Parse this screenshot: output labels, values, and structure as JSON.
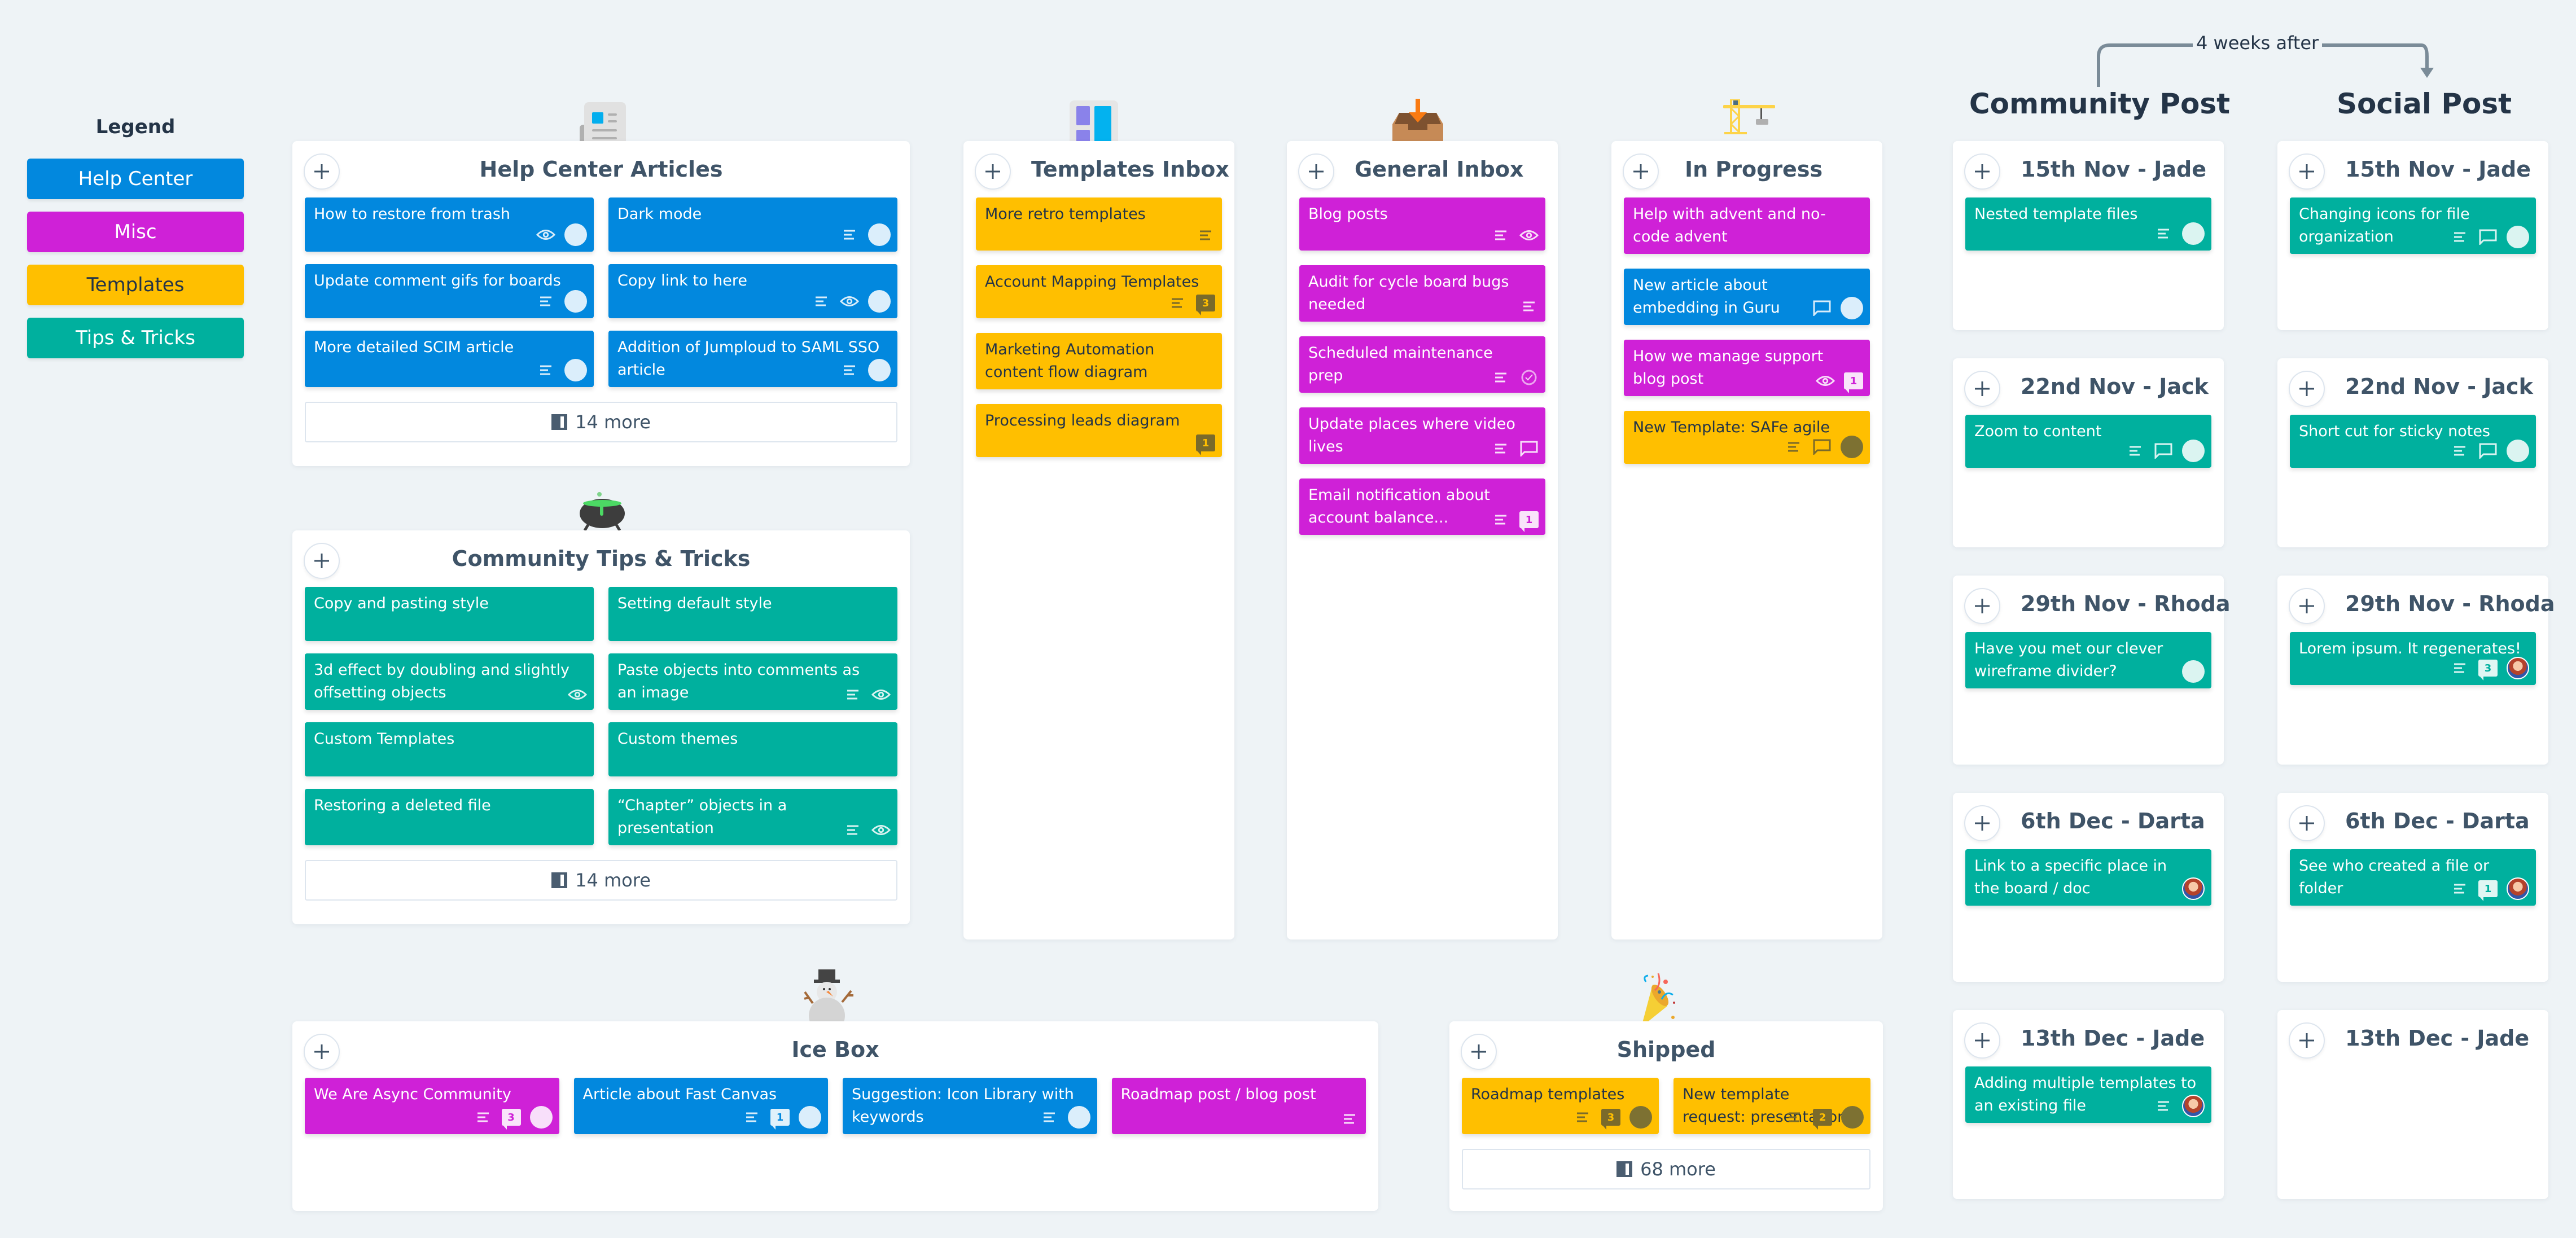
{
  "colors": {
    "help_center": "#0288de",
    "misc": "#cf21d7",
    "templates": "#ffbf00",
    "tips_tricks": "#00b09e",
    "background": "#eef3f6",
    "title_text": "#3f5468"
  },
  "legend": {
    "title": "Legend",
    "items": [
      {
        "label": "Help Center",
        "category": "help_center"
      },
      {
        "label": "Misc",
        "category": "misc"
      },
      {
        "label": "Templates",
        "category": "templates"
      },
      {
        "label": "Tips & Tricks",
        "category": "tips_tricks"
      }
    ]
  },
  "columns": {
    "help_center_articles": {
      "title": "Help Center Articles",
      "icon": "newspaper-icon",
      "more_label": "14 more",
      "cards": [
        {
          "text": "How to restore from trash",
          "category": "help_center",
          "meta": [
            "eye",
            "avatar"
          ]
        },
        {
          "text": "Dark mode",
          "category": "help_center",
          "meta": [
            "notes",
            "avatar"
          ]
        },
        {
          "text": "Update comment gifs for boards",
          "category": "help_center",
          "meta": [
            "notes",
            "avatar"
          ]
        },
        {
          "text": "Copy link to here",
          "category": "help_center",
          "meta": [
            "notes",
            "eye",
            "avatar"
          ]
        },
        {
          "text": "More detailed SCIM article",
          "category": "help_center",
          "meta": [
            "notes",
            "avatar"
          ]
        },
        {
          "text": "Addition of Jumploud to SAML SSO article",
          "category": "help_center",
          "meta": [
            "notes",
            "avatar"
          ]
        }
      ]
    },
    "community_tips": {
      "title": "Community Tips & Tricks",
      "icon": "cauldron-icon",
      "more_label": "14 more",
      "cards": [
        {
          "text": "Copy and pasting style",
          "category": "tips_tricks",
          "meta": []
        },
        {
          "text": "Setting default style",
          "category": "tips_tricks",
          "meta": []
        },
        {
          "text": "3d effect by doubling and slightly offsetting objects",
          "category": "tips_tricks",
          "meta": [
            "eye"
          ]
        },
        {
          "text": "Paste objects into comments as an image",
          "category": "tips_tricks",
          "meta": [
            "notes",
            "eye"
          ]
        },
        {
          "text": "Custom Templates",
          "category": "tips_tricks",
          "meta": []
        },
        {
          "text": "Custom themes",
          "category": "tips_tricks",
          "meta": []
        },
        {
          "text": "Restoring a deleted file",
          "category": "tips_tricks",
          "meta": []
        },
        {
          "text": "“Chapter” objects in a presentation",
          "category": "tips_tricks",
          "meta": [
            "notes",
            "eye"
          ]
        }
      ]
    },
    "templates_inbox": {
      "title": "Templates Inbox",
      "icon": "layout-icon",
      "cards": [
        {
          "text": "More retro templates",
          "category": "templates",
          "meta": [
            "notes"
          ]
        },
        {
          "text": "Account Mapping Templates",
          "category": "templates",
          "meta": [
            "notes",
            "comments:3"
          ]
        },
        {
          "text": "Marketing Automation content flow diagram",
          "category": "templates",
          "meta": []
        },
        {
          "text": "Processing leads diagram",
          "category": "templates",
          "meta": [
            "comments:1"
          ]
        }
      ]
    },
    "general_inbox": {
      "title": "General Inbox",
      "icon": "inbox-tray-icon",
      "cards": [
        {
          "text": "Blog posts",
          "category": "misc",
          "meta": [
            "notes",
            "eye"
          ]
        },
        {
          "text": "Audit for cycle board bugs needed",
          "category": "misc",
          "meta": [
            "notes"
          ]
        },
        {
          "text": "Scheduled maintenance prep",
          "category": "misc",
          "meta": [
            "notes",
            "progress"
          ]
        },
        {
          "text": "Update places where video lives",
          "category": "misc",
          "meta": [
            "notes",
            "comment"
          ]
        },
        {
          "text": "Email notification about account balance...",
          "category": "misc",
          "meta": [
            "notes",
            "comments:1"
          ]
        }
      ]
    },
    "in_progress": {
      "title": "In Progress",
      "icon": "crane-icon",
      "cards": [
        {
          "text": "Help with advent and no-code advent",
          "category": "misc",
          "meta": []
        },
        {
          "text": "New article about embedding in Guru",
          "category": "help_center",
          "meta": [
            "comment",
            "avatar"
          ]
        },
        {
          "text": "How we manage support blog post",
          "category": "misc",
          "meta": [
            "eye",
            "comments:1"
          ]
        },
        {
          "text": "New Template: SAFe agile",
          "category": "templates",
          "meta": [
            "notes",
            "comment",
            "avatar"
          ]
        }
      ]
    },
    "ice_box": {
      "title": "Ice Box",
      "icon": "snowman-icon",
      "cards": [
        {
          "text": "We Are Async Community",
          "category": "misc",
          "meta": [
            "notes",
            "comments:3",
            "avatar"
          ]
        },
        {
          "text": "Article about Fast Canvas",
          "category": "help_center",
          "meta": [
            "notes",
            "comments:1",
            "avatar"
          ]
        },
        {
          "text": "Suggestion: Icon Library with keywords",
          "category": "help_center",
          "meta": [
            "notes",
            "avatar"
          ]
        },
        {
          "text": "Roadmap post / blog post",
          "category": "misc",
          "meta": [
            "notes"
          ]
        }
      ]
    },
    "shipped": {
      "title": "Shipped",
      "icon": "party-popper-icon",
      "more_label": "68 more",
      "cards": [
        {
          "text": "Roadmap templates",
          "category": "templates",
          "meta": [
            "notes",
            "comments:3",
            "avatar"
          ]
        },
        {
          "text": "New template request: presentation",
          "category": "templates",
          "meta": [
            "notes",
            "comments:2",
            "avatar"
          ]
        }
      ]
    }
  },
  "schedule": {
    "connector_label": "4 weeks after",
    "community_post": {
      "title": "Community Post",
      "slots": [
        {
          "title": "15th Nov - Jade",
          "cards": [
            {
              "text": "Nested template files",
              "category": "tips_tricks",
              "meta": [
                "notes",
                "avatar"
              ]
            }
          ]
        },
        {
          "title": "22nd Nov - Jack",
          "cards": [
            {
              "text": "Zoom to content",
              "category": "tips_tricks",
              "meta": [
                "notes",
                "comment",
                "avatar"
              ]
            }
          ]
        },
        {
          "title": "29th Nov - Rhoda",
          "cards": [
            {
              "text": "Have you met our clever wireframe divider?",
              "category": "tips_tricks",
              "meta": [
                "avatar"
              ]
            }
          ]
        },
        {
          "title": "6th Dec - Darta",
          "cards": [
            {
              "text": "Link to a specific place in the board / doc",
              "category": "tips_tricks",
              "meta": [
                "avatar-photo"
              ]
            }
          ]
        },
        {
          "title": "13th Dec - Jade",
          "cards": [
            {
              "text": "Adding multiple templates to an existing file",
              "category": "tips_tricks",
              "meta": [
                "notes",
                "avatar-photo"
              ]
            }
          ]
        }
      ]
    },
    "social_post": {
      "title": "Social Post",
      "slots": [
        {
          "title": "15th Nov - Jade",
          "cards": [
            {
              "text": "Changing icons for file organization",
              "category": "tips_tricks",
              "meta": [
                "notes",
                "comment",
                "avatar"
              ]
            }
          ]
        },
        {
          "title": "22nd Nov - Jack",
          "cards": [
            {
              "text": "Short cut for sticky notes",
              "category": "tips_tricks",
              "meta": [
                "notes",
                "comment",
                "avatar"
              ]
            }
          ]
        },
        {
          "title": "29th Nov - Rhoda",
          "cards": [
            {
              "text": "Lorem ipsum. It regenerates!",
              "category": "tips_tricks",
              "meta": [
                "notes",
                "comments:3",
                "avatar-photo"
              ]
            }
          ]
        },
        {
          "title": "6th Dec - Darta",
          "cards": [
            {
              "text": "See who created a file or folder",
              "category": "tips_tricks",
              "meta": [
                "notes",
                "comments:1",
                "avatar-photo"
              ]
            }
          ]
        },
        {
          "title": "13th Dec - Jade",
          "cards": []
        }
      ]
    }
  }
}
